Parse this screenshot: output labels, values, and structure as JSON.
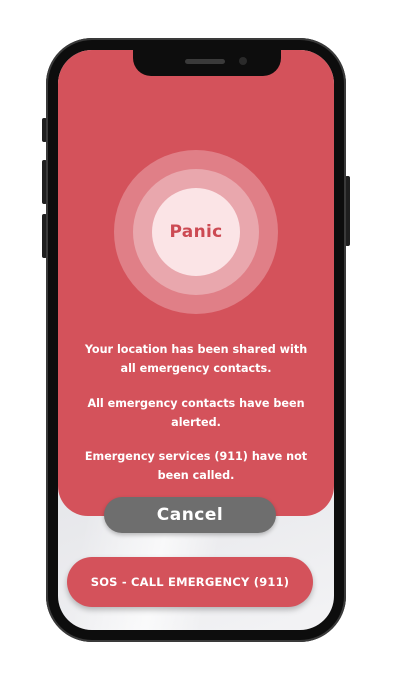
{
  "panic": {
    "title": "Panic"
  },
  "messages": [
    "Your location has been shared with all emergency contacts.",
    "All emergency contacts have been alerted.",
    "Emergency services (911) have not been called."
  ],
  "buttons": {
    "cancel_label": "Cancel",
    "sos_label": "SOS - CALL EMERGENCY (911)"
  },
  "colors": {
    "accent_red": "#d4525b",
    "cancel_gray": "#6e6e6e",
    "panic_text": "#cc4a53"
  }
}
